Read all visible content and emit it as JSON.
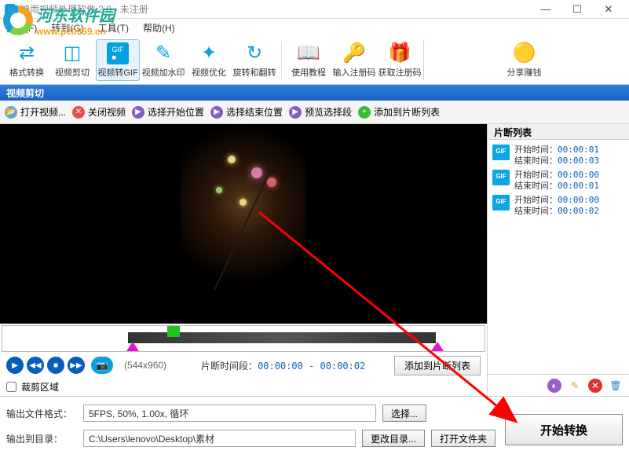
{
  "window": {
    "title": "神雨视频处理软件 2.0 - 未注册",
    "min": "—",
    "max": "☐",
    "close": "✕"
  },
  "menu": {
    "file": "文件(F)",
    "convert": "转到(G)",
    "tool": "工具(T)",
    "help": "帮助(H)"
  },
  "watermark": {
    "name": "河东软件园",
    "url": "www.pc0359.cn"
  },
  "toolbar": {
    "format": "格式转换",
    "clip": "视频剪切",
    "gif": "视频转GIF",
    "watermark": "视频加水印",
    "optimize": "视频优化",
    "rotate": "旋转和翻转",
    "tutorial": "使用教程",
    "regcode": "输入注册码",
    "getcode": "获取注册码",
    "share": "分享赚钱"
  },
  "section": "视频剪切",
  "actions": {
    "open": "打开视频...",
    "close": "关闭视频",
    "startpos": "选择开始位置",
    "endpos": "选择结束位置",
    "preview": "预览选择段",
    "addseg": "添加到片断列表"
  },
  "controls": {
    "dimensions": "(544x960)",
    "seglabel": "片断时间段：",
    "segval": "00:00:00 - 00:00:02",
    "addsegbtn": "添加到片断列表",
    "croparea": "裁剪区域"
  },
  "rightpanel": {
    "title": "片断列表",
    "startlabel": "开始时间：",
    "endlabel": "结束时间：",
    "items": [
      {
        "start": "00:00:01",
        "end": "00:00:03"
      },
      {
        "start": "00:00:00",
        "end": "00:00:01"
      },
      {
        "start": "00:00:00",
        "end": "00:00:02"
      }
    ]
  },
  "output": {
    "formatlabel": "输出文件格式：",
    "formatval": "5FPS, 50%, 1.00x, 循环",
    "choosebtn": "选择...",
    "dirlabel": "输出到目录：",
    "dirval": "C:\\Users\\lenovo\\Desktop\\素材",
    "changedir": "更改目录...",
    "openfolder": "打开文件夹",
    "start": "开始转换"
  }
}
